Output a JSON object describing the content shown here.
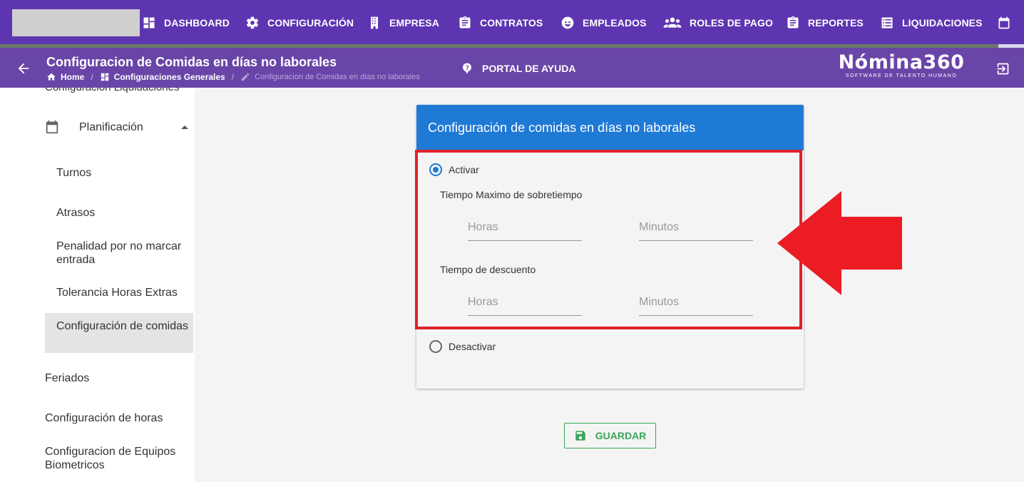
{
  "nav": {
    "items": [
      {
        "label": "DASHBOARD",
        "icon": "dashboard-icon"
      },
      {
        "label": "CONFIGURACIÓN",
        "icon": "gear-icon"
      },
      {
        "label": "EMPRESA",
        "icon": "building-icon"
      },
      {
        "label": "CONTRATOS",
        "icon": "clipboard-icon"
      },
      {
        "label": "EMPLEADOS",
        "icon": "face-icon"
      },
      {
        "label": "ROLES DE PAGO",
        "icon": "people-icon"
      },
      {
        "label": "REPORTES",
        "icon": "clipboard-icon"
      },
      {
        "label": "LIQUIDACIONES",
        "icon": "list-icon"
      }
    ]
  },
  "header": {
    "title": "Configuracion de Comidas en días no laborales",
    "breadcrumb": [
      "Home",
      "Configuraciones Generales",
      "Configuracion de Comidas en días no laborales"
    ],
    "help": "PORTAL DE AYUDA",
    "brand_name": "Nómina360",
    "brand_sub": "SOFTWARE DE TALENTO HUMANO"
  },
  "sidebar": {
    "cut_item": "Configuración Liquidaciones",
    "group": "Planificación",
    "sub_items": [
      "Turnos",
      "Atrasos",
      "Penalidad por no marcar entrada",
      "Tolerancia Horas Extras",
      "Configuración de comidas"
    ],
    "items": [
      "Feriados",
      "Configuración de horas",
      "Configuracion de Equipos Biometricos"
    ]
  },
  "card": {
    "title": "Configuración de comidas en días no laborales",
    "activar": "Activar",
    "desactivar": "Desactivar",
    "selected": "Activar",
    "max_label": "Tiempo Maximo de sobretiempo",
    "desc_label": "Tiempo de descuento",
    "horas_placeholder": "Horas",
    "minutos_placeholder": "Minutos"
  },
  "actions": {
    "save": "GUARDAR"
  },
  "colors": {
    "nav": "#5e35b1",
    "subheader": "#6a45a8",
    "card_header": "#1f7ad6",
    "highlight": "#e0212b",
    "save": "#3aa55a"
  }
}
